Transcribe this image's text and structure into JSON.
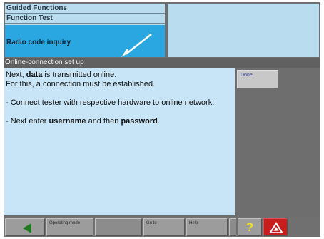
{
  "navigation": {
    "items": [
      {
        "label": "Guided Functions"
      },
      {
        "label": "Function Test"
      },
      {
        "label": "Radio code inquiry",
        "active": true
      }
    ]
  },
  "section": {
    "title": "Online-connection set up"
  },
  "content": {
    "line1_prefix": "Next, ",
    "line1_bold": "data",
    "line1_suffix": " is transmitted online.",
    "line2": "For this, a connection must be established.",
    "instruction1": "- Connect tester with respective hardware to online network.",
    "instruction2_prefix": "- Next enter ",
    "instruction2_bold1": "username",
    "instruction2_mid": " and then ",
    "instruction2_bold2": "password",
    "instruction2_suffix": "."
  },
  "side": {
    "done_label": "Done"
  },
  "toolbar": {
    "operating_label": "Operating mode",
    "goto_label": "Go to",
    "help_label": "Help",
    "question_glyph": "?",
    "icons": [
      "back-arrow-icon",
      "question-mark-icon",
      "warning-triangle-icon"
    ],
    "colors": {
      "back_arrow": "#1f7a1f",
      "question_mark": "#f4e020",
      "warning_background": "#c71d1d"
    }
  }
}
